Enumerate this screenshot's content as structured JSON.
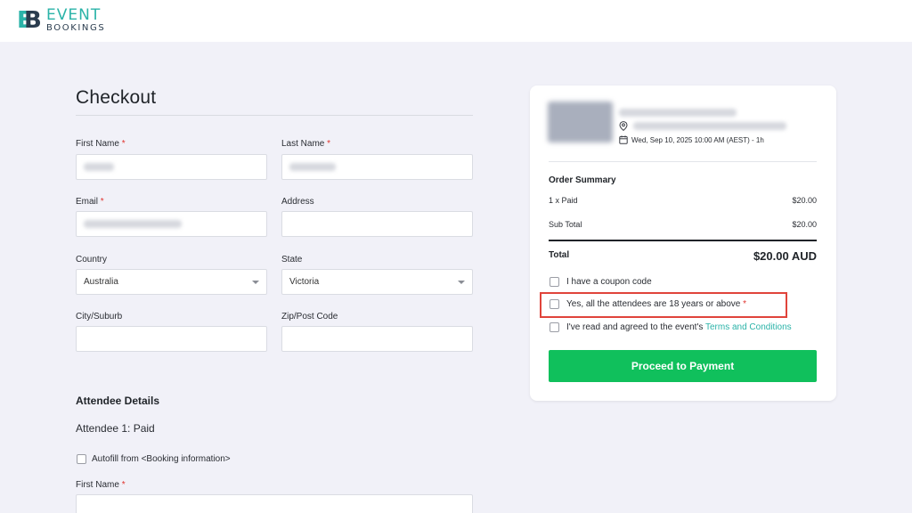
{
  "brand": {
    "line1": "EVENT",
    "line2": "BOOKINGS",
    "mark1": "E",
    "mark2": "B"
  },
  "checkout": {
    "title": "Checkout",
    "first_name": {
      "label": "First Name",
      "required": "*"
    },
    "last_name": {
      "label": "Last Name",
      "required": "*"
    },
    "email": {
      "label": "Email",
      "required": "*"
    },
    "address": {
      "label": "Address",
      "value": ""
    },
    "country": {
      "label": "Country",
      "value": "Australia"
    },
    "state": {
      "label": "State",
      "value": "Victoria"
    },
    "city": {
      "label": "City/Suburb",
      "value": ""
    },
    "zip": {
      "label": "Zip/Post Code",
      "value": ""
    }
  },
  "attendee": {
    "section_title": "Attendee Details",
    "title": "Attendee 1: Paid",
    "autofill_label": "Autofill from <Booking information>",
    "first_name": {
      "label": "First Name",
      "required": "*"
    }
  },
  "summary": {
    "event_date": "Wed, Sep 10, 2025 10:00 AM (AEST) - 1h",
    "title": "Order Summary",
    "item_label": "1 x Paid",
    "item_value": "$20.00",
    "subtotal_label": "Sub Total",
    "subtotal_value": "$20.00",
    "total_label": "Total",
    "total_value": "$20.00 AUD",
    "coupon_label": "I have a coupon code",
    "age_label": "Yes, all the attendees are 18 years or above",
    "age_required": "*",
    "terms_prefix": "I've read and agreed to the event's ",
    "terms_link": "Terms and Conditions",
    "pay_button": "Proceed to Payment"
  },
  "colors": {
    "accent": "#2bb3a8",
    "pay": "#10c05c",
    "highlight": "#e0443b",
    "required": "#e0342e"
  }
}
